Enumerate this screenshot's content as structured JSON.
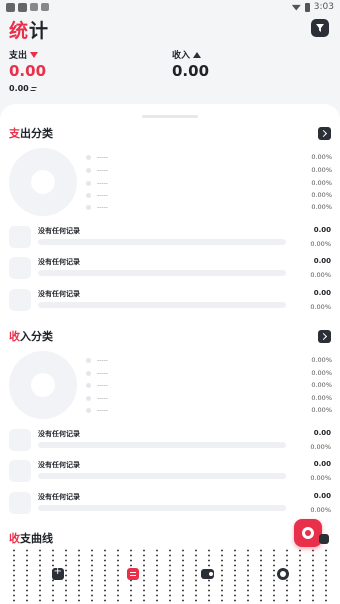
{
  "status_bar": {
    "time": "3:03"
  },
  "header": {
    "title_first": "统",
    "title_rest": "计"
  },
  "summary": {
    "expense_label": "支出",
    "expense_value": "0.00",
    "income_label": "收入",
    "income_value": "0.00",
    "balance": "0.00"
  },
  "expense_section": {
    "title_first": "支",
    "title_rest": "出分类",
    "legend": [
      {
        "name": "-----",
        "pct": "0.00%"
      },
      {
        "name": "-----",
        "pct": "0.00%"
      },
      {
        "name": "-----",
        "pct": "0.00%"
      },
      {
        "name": "-----",
        "pct": "0.00%"
      },
      {
        "name": "-----",
        "pct": "0.00%"
      }
    ],
    "records": [
      {
        "label": "没有任何记录",
        "amount": "0.00",
        "pct": "0.00%"
      },
      {
        "label": "没有任何记录",
        "amount": "0.00",
        "pct": "0.00%"
      },
      {
        "label": "没有任何记录",
        "amount": "0.00",
        "pct": "0.00%"
      }
    ]
  },
  "income_section": {
    "title_first": "收",
    "title_rest": "入分类",
    "legend": [
      {
        "name": "-----",
        "pct": "0.00%"
      },
      {
        "name": "-----",
        "pct": "0.00%"
      },
      {
        "name": "-----",
        "pct": "0.00%"
      },
      {
        "name": "-----",
        "pct": "0.00%"
      },
      {
        "name": "-----",
        "pct": "0.00%"
      }
    ],
    "records": [
      {
        "label": "没有任何记录",
        "amount": "0.00",
        "pct": "0.00%"
      },
      {
        "label": "没有任何记录",
        "amount": "0.00",
        "pct": "0.00%"
      },
      {
        "label": "没有任何记录",
        "amount": "0.00",
        "pct": "0.00%"
      }
    ]
  },
  "trend_section": {
    "title_first": "收",
    "title_rest": "支曲线"
  },
  "tabs": [
    {
      "icon": "add-icon"
    },
    {
      "icon": "stats-icon"
    },
    {
      "icon": "wallet-icon"
    },
    {
      "icon": "profile-icon"
    }
  ],
  "colors": {
    "accent": "#e8304b",
    "dark": "#2b2f36"
  }
}
